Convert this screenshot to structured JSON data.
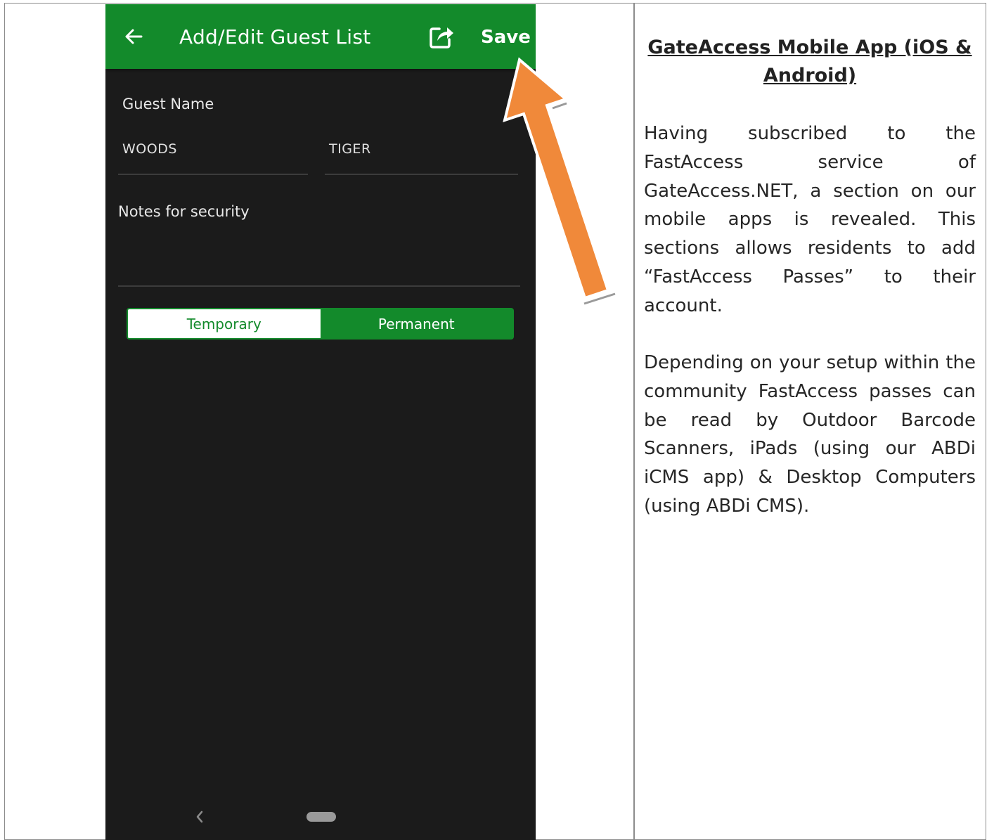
{
  "app": {
    "title": "Add/Edit Guest List",
    "save_label": "Save",
    "icons": {
      "back": "arrow-left-icon",
      "share": "share-icon"
    },
    "brand_color": "#138a2b",
    "background_color": "#1b1b1b"
  },
  "form": {
    "guest_name_label": "Guest Name",
    "last_name_value": "WOODS",
    "first_name_value": "TIGER",
    "notes_label": "Notes for security"
  },
  "segmented": {
    "options": [
      {
        "label": "Temporary",
        "selected": true
      },
      {
        "label": "Permanent",
        "selected": false
      }
    ]
  },
  "nav": {
    "icons": {
      "back": "chevron-left-icon",
      "home": "home-pill-icon"
    }
  },
  "annotation": {
    "arrow_color": "#f0893a",
    "arrow_icon": "orange-pointer-arrow"
  },
  "doc": {
    "title": "GateAccess Mobile App (iOS & Android)",
    "paragraph_1": "Having subscribed to the FastAccess service of GateAccess.NET, a section on our mobile apps is revealed. This sections allows residents to add “FastAccess Passes” to their account.",
    "paragraph_2": "Depending on your setup within the community FastAccess passes can be read by Outdoor Barcode Scanners, iPads (using our ABDi iCMS app) & Desktop Computers (using ABDi CMS)."
  }
}
